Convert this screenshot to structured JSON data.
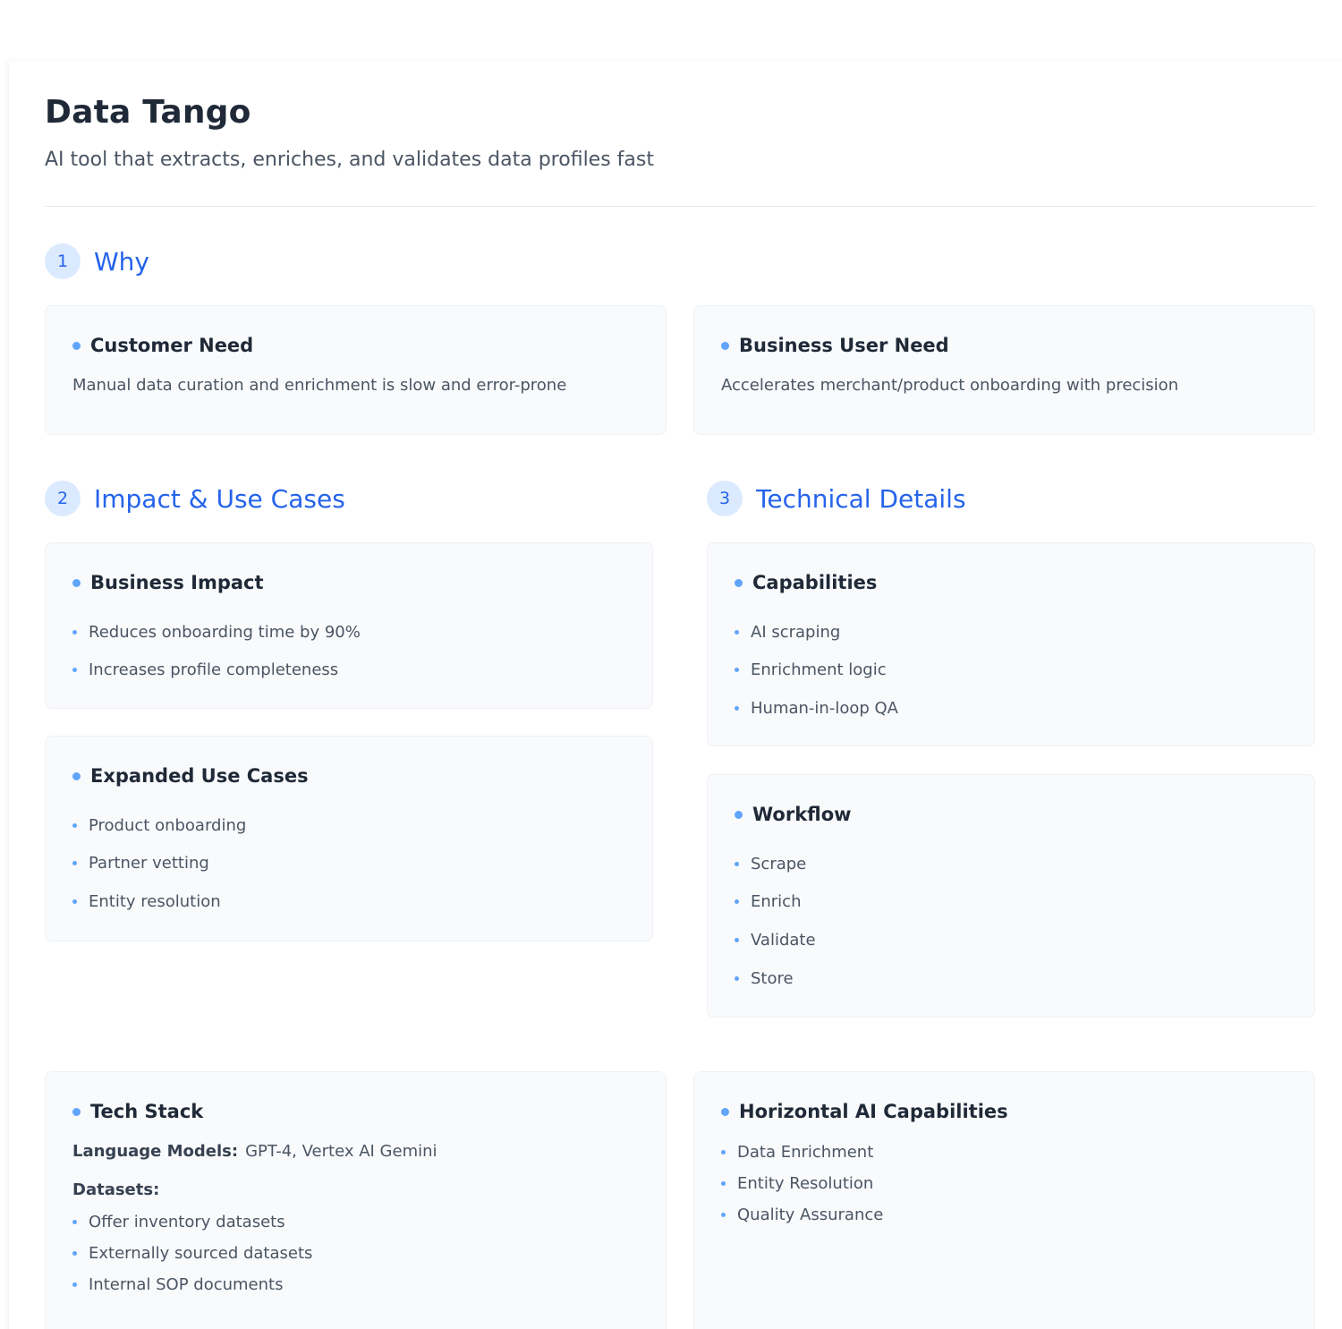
{
  "header": {
    "title": "Data Tango",
    "subtitle": "AI tool that extracts, enriches, and validates data profiles fast"
  },
  "sections": {
    "why": {
      "number": "1",
      "title": "Why"
    },
    "impact": {
      "number": "2",
      "title": "Impact & Use Cases"
    },
    "technical": {
      "number": "3",
      "title": "Technical Details"
    }
  },
  "cards": {
    "customer_need": {
      "title": "Customer Need",
      "text": "Manual data curation and enrichment is slow and error-prone"
    },
    "business_user_need": {
      "title": "Business User Need",
      "text": "Accelerates merchant/product onboarding with precision"
    },
    "business_impact": {
      "title": "Business Impact",
      "items": [
        "Reduces onboarding time by 90%",
        "Increases profile completeness"
      ]
    },
    "expanded_use_cases": {
      "title": "Expanded Use Cases",
      "items": [
        "Product onboarding",
        "Partner vetting",
        "Entity resolution"
      ]
    },
    "capabilities": {
      "title": "Capabilities",
      "items": [
        "AI scraping",
        "Enrichment logic",
        "Human-in-loop QA"
      ]
    },
    "workflow": {
      "title": "Workflow",
      "items": [
        "Scrape",
        "Enrich",
        "Validate",
        "Store"
      ]
    },
    "tech_stack": {
      "title": "Tech Stack",
      "language_models_label": "Language Models:",
      "language_models_value": "GPT-4, Vertex AI Gemini",
      "datasets_label": "Datasets:",
      "datasets": [
        "Offer inventory datasets",
        "Externally sourced datasets",
        "Internal SOP documents"
      ]
    },
    "horizontal_ai": {
      "title": "Horizontal AI Capabilities",
      "items": [
        "Data Enrichment",
        "Entity Resolution",
        "Quality Assurance"
      ]
    }
  },
  "colors": {
    "accent": "#2563eb",
    "badge_bg": "#dbeafe",
    "bullet": "#60a5fa",
    "card_bg": "#f8fafc"
  }
}
